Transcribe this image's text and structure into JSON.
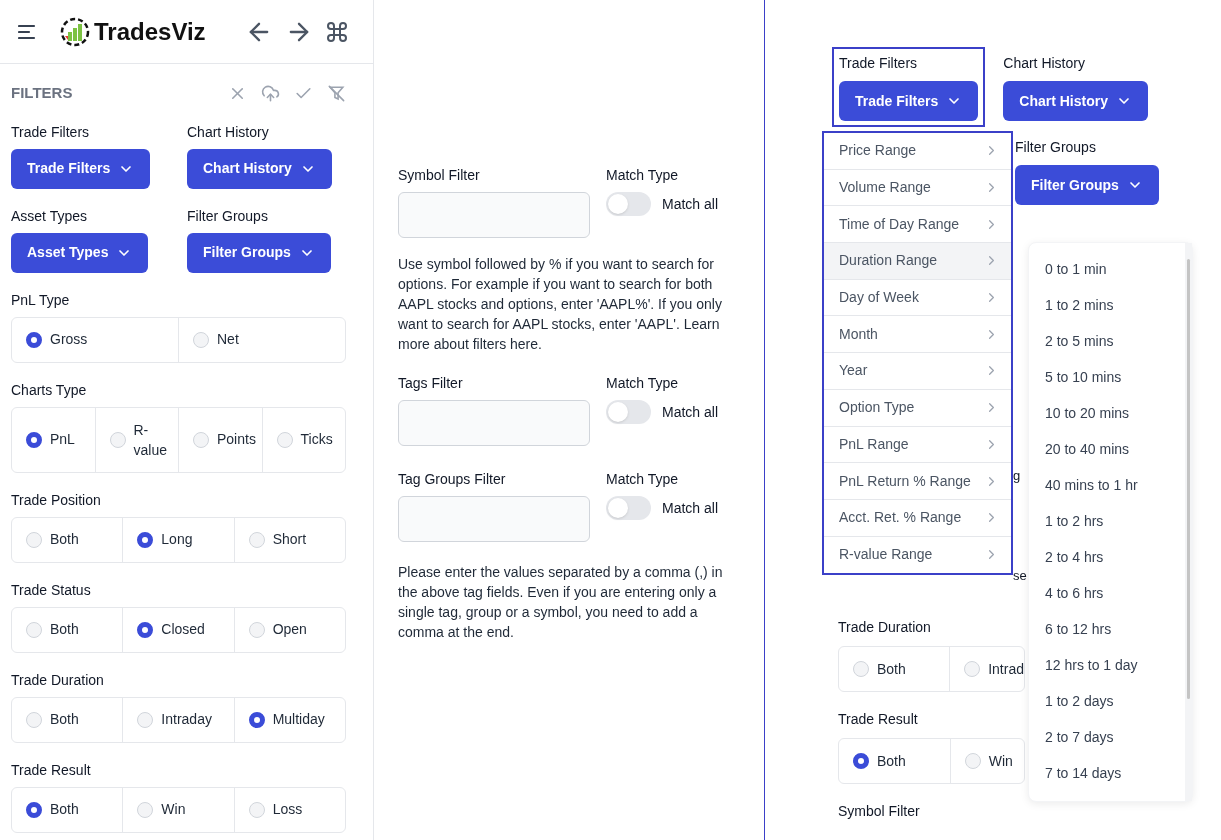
{
  "header": {
    "logo_text": "TradesViz"
  },
  "sidebar": {
    "title": "FILTERS",
    "dropdowns": [
      {
        "label": "Trade Filters",
        "button": "Trade Filters"
      },
      {
        "label": "Chart History",
        "button": "Chart History"
      },
      {
        "label": "Asset Types",
        "button": "Asset Types"
      },
      {
        "label": "Filter Groups",
        "button": "Filter Groups"
      }
    ],
    "radio_groups": [
      {
        "label": "PnL Type",
        "options": [
          {
            "label": "Gross",
            "selected": true
          },
          {
            "label": "Net",
            "selected": false
          }
        ]
      },
      {
        "label": "Charts Type",
        "options": [
          {
            "label": "PnL",
            "selected": true
          },
          {
            "label": "R-value",
            "selected": false
          },
          {
            "label": "Points",
            "selected": false
          },
          {
            "label": "Ticks",
            "selected": false
          }
        ]
      },
      {
        "label": "Trade Position",
        "options": [
          {
            "label": "Both",
            "selected": false
          },
          {
            "label": "Long",
            "selected": true
          },
          {
            "label": "Short",
            "selected": false
          }
        ]
      },
      {
        "label": "Trade Status",
        "options": [
          {
            "label": "Both",
            "selected": false
          },
          {
            "label": "Closed",
            "selected": true
          },
          {
            "label": "Open",
            "selected": false
          }
        ]
      },
      {
        "label": "Trade Duration",
        "options": [
          {
            "label": "Both",
            "selected": false
          },
          {
            "label": "Intraday",
            "selected": false
          },
          {
            "label": "Multiday",
            "selected": true
          }
        ]
      },
      {
        "label": "Trade Result",
        "options": [
          {
            "label": "Both",
            "selected": true
          },
          {
            "label": "Win",
            "selected": false
          },
          {
            "label": "Loss",
            "selected": false
          }
        ]
      }
    ]
  },
  "middle": {
    "filters": [
      {
        "label": "Symbol Filter",
        "match_label": "Match Type",
        "toggle_text": "Match all",
        "on": false,
        "help": "Use symbol followed by % if you want to search for options. For example if you want to search for both AAPL stocks and options, enter 'AAPL%'. If you only want to search for AAPL stocks, enter 'AAPL'. Learn more about filters here."
      },
      {
        "label": "Tags Filter",
        "match_label": "Match Type",
        "toggle_text": "Match all",
        "on": false
      },
      {
        "label": "Tag Groups Filter",
        "match_label": "Match Type",
        "toggle_text": "Match all",
        "on": false
      }
    ],
    "note": "Please enter the values separated by a comma (,) in the above tag fields. Even if you are entering only a single tag, group or a symbol, you need to add a comma at the end."
  },
  "right": {
    "dropdowns": [
      {
        "label": "Trade Filters",
        "button": "Trade Filters",
        "outlined": true
      },
      {
        "label": "Chart History",
        "button": "Chart History",
        "outlined": false
      }
    ],
    "filter_groups": {
      "label": "Filter Groups",
      "button": "Filter Groups"
    },
    "fragments": [
      "g",
      "se"
    ],
    "menu": [
      {
        "label": "Price Range",
        "highlighted": false
      },
      {
        "label": "Volume Range",
        "highlighted": false
      },
      {
        "label": "Time of Day Range",
        "highlighted": false
      },
      {
        "label": "Duration Range",
        "highlighted": true
      },
      {
        "label": "Day of Week",
        "highlighted": false
      },
      {
        "label": "Month",
        "highlighted": false
      },
      {
        "label": "Year",
        "highlighted": false
      },
      {
        "label": "Option Type",
        "highlighted": false
      },
      {
        "label": "PnL Range",
        "highlighted": false
      },
      {
        "label": "PnL Return % Range",
        "highlighted": false
      },
      {
        "label": "Acct. Ret. % Range",
        "highlighted": false
      },
      {
        "label": "R-value Range",
        "highlighted": false
      }
    ],
    "submenu": [
      "0 to 1 min",
      "1 to 2 mins",
      "2 to 5 mins",
      "5 to 10 mins",
      "10 to 20 mins",
      "20 to 40 mins",
      "40 mins to 1 hr",
      "1 to 2 hrs",
      "2 to 4 hrs",
      "4 to 6 hrs",
      "6 to 12 hrs",
      "12 hrs to 1 day",
      "1 to 2 days",
      "2 to 7 days",
      "7 to 14 days"
    ],
    "radio_groups": [
      {
        "label": "Trade Duration",
        "options": [
          {
            "label": "Both",
            "selected": false
          },
          {
            "label": "Intrad",
            "selected": false
          }
        ]
      },
      {
        "label": "Trade Result",
        "options": [
          {
            "label": "Both",
            "selected": true
          },
          {
            "label": "Win",
            "selected": false
          }
        ]
      }
    ],
    "trailing_label": "Symbol Filter"
  }
}
